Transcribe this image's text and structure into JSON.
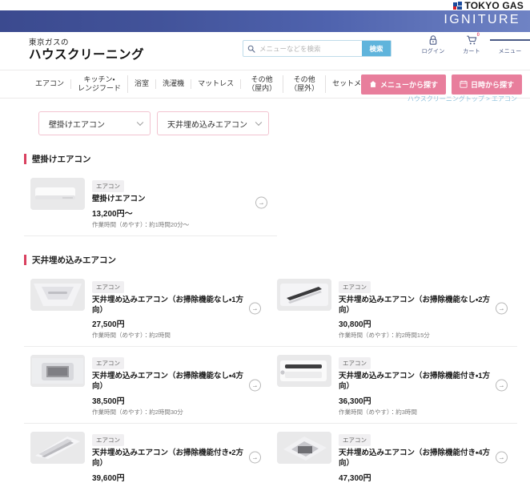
{
  "corporate": {
    "logo_text": "TOKYO GAS",
    "banner_text": "IGNITURE",
    "banner_gradient_from": "#3b4a8f",
    "banner_gradient_to": "#6f83c4"
  },
  "header": {
    "site_subtitle": "東京ガスの",
    "site_title": "ハウスクリーニング",
    "search": {
      "placeholder": "メニューなどを検索",
      "value": "",
      "button_label": "検索",
      "icon": "search-icon",
      "button_color": "#5fb4dc"
    },
    "actions": [
      {
        "label": "ログイン",
        "icon": "lock-icon"
      },
      {
        "label": "カート",
        "icon": "cart-icon",
        "badge": "0"
      },
      {
        "label": "メニュー",
        "icon": "hamburger-icon"
      }
    ]
  },
  "category_nav": {
    "items": [
      {
        "label": "エアコン"
      },
      {
        "label": "キッチン・\nレンジフード"
      },
      {
        "label": "浴室"
      },
      {
        "label": "洗濯機"
      },
      {
        "label": "マットレス"
      },
      {
        "label": "その他\n（屋内）"
      },
      {
        "label": "その他\n（屋外）"
      },
      {
        "label": "セットメニュー"
      }
    ],
    "buttons": [
      {
        "label": "メニューから探す",
        "icon": "house-menu-icon",
        "color": "#e87e9c"
      },
      {
        "label": "日時から探す",
        "icon": "calendar-icon",
        "color": "#e87e9c"
      }
    ],
    "breadcrumb_clipped": "ハウスクリーニングトップ > エアコン"
  },
  "filters": [
    {
      "value": "壁掛けエアコン",
      "icon": "chevron-down-icon"
    },
    {
      "value": "天井埋め込みエアコン",
      "icon": "chevron-down-icon"
    }
  ],
  "sections": [
    {
      "title": "壁掛けエアコン",
      "accent": "#d9405f",
      "products": [
        {
          "tag": "エアコン",
          "name": "壁掛けエアコン",
          "price": "13,200円〜",
          "duration": "作業時間（めやす）：約1時間20分〜",
          "thumb": "wall-aircon"
        }
      ]
    },
    {
      "title": "天井埋め込みエアコン",
      "accent": "#d9405f",
      "products": [
        {
          "tag": "エアコン",
          "name": "天井埋め込みエアコン（お掃除機能なし・1方向）",
          "price": "27,500円",
          "duration": "作業時間（めやす）：約2時間",
          "thumb": "ceiling-1way"
        },
        {
          "tag": "エアコン",
          "name": "天井埋め込みエアコン（お掃除機能なし・2方向）",
          "price": "30,800円",
          "duration": "作業時間（めやす）：約2時間15分",
          "thumb": "ceiling-2way"
        },
        {
          "tag": "エアコン",
          "name": "天井埋め込みエアコン（お掃除機能なし・4方向）",
          "price": "38,500円",
          "duration": "作業時間（めやす）：約2時間30分",
          "thumb": "ceiling-4way"
        },
        {
          "tag": "エアコン",
          "name": "天井埋め込みエアコン（お掃除機能付き・1方向）",
          "price": "36,300円",
          "duration": "作業時間（めやす）：約3時間",
          "thumb": "ceiling-1way-clean"
        },
        {
          "tag": "エアコン",
          "name": "天井埋め込みエアコン（お掃除機能付き・2方向）",
          "price": "39,600円",
          "duration": "",
          "thumb": "ceiling-2way-clean"
        },
        {
          "tag": "エアコン",
          "name": "天井埋め込みエアコン（お掃除機能付き・4方向）",
          "price": "47,300円",
          "duration": "",
          "thumb": "ceiling-4way-clean"
        }
      ]
    }
  ]
}
